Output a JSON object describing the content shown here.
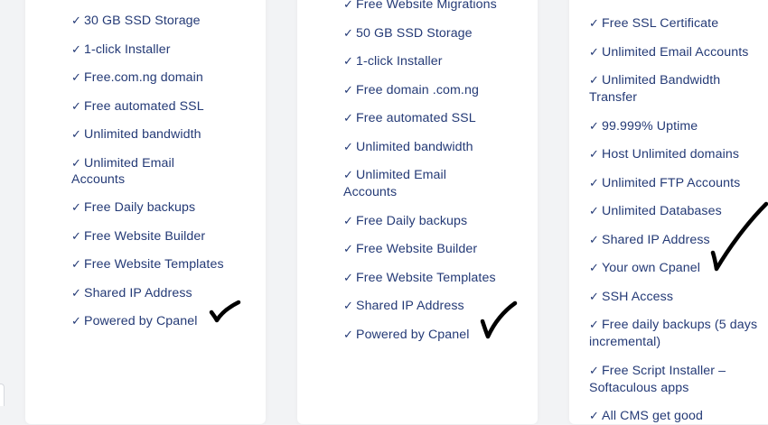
{
  "plans": [
    {
      "features": [
        [
          "30 GB SSD Storage"
        ],
        [
          "1-click Installer"
        ],
        [
          "Free.com.ng domain"
        ],
        [
          "Free automated SSL"
        ],
        [
          "Unlimited bandwidth"
        ],
        [
          "Unlimited Email",
          "Accounts"
        ],
        [
          "Free Daily backups"
        ],
        [
          "Free Website Builder"
        ],
        [
          "Free Website Templates"
        ],
        [
          "Shared IP Address"
        ],
        [
          "Powered by Cpanel"
        ]
      ]
    },
    {
      "features": [
        [
          "Free Website Migrations"
        ],
        [
          "50 GB SSD Storage"
        ],
        [
          "1-click Installer"
        ],
        [
          "Free domain .com.ng"
        ],
        [
          "Free automated SSL"
        ],
        [
          "Unlimited bandwidth"
        ],
        [
          "Unlimited Email",
          "Accounts"
        ],
        [
          "Free Daily backups"
        ],
        [
          "Free Website Builder"
        ],
        [
          "Free Website Templates"
        ],
        [
          "Shared IP Address"
        ],
        [
          "Powered by Cpanel"
        ]
      ]
    },
    {
      "features": [
        [
          "Free SSL Certificate"
        ],
        [
          "Unlimited Email Accounts"
        ],
        [
          "Unlimited Bandwidth",
          "Transfer"
        ],
        [
          "99.999% Uptime"
        ],
        [
          "Host Unlimited domains"
        ],
        [
          "Unlimited FTP Accounts"
        ],
        [
          "Unlimited Databases"
        ],
        [
          "Shared IP Address"
        ],
        [
          "Your own Cpanel"
        ],
        [
          "SSH Access"
        ],
        [
          "Free daily backups (5 days",
          "incremental)"
        ],
        [
          "Free Script Installer –",
          "Softaculous apps"
        ],
        [
          "All CMS get good"
        ]
      ]
    }
  ],
  "check_glyph": "✓",
  "colors": {
    "text": "#243a76",
    "card": "#ffffff",
    "background": "#f2f3f5",
    "annotation": "#000000"
  }
}
